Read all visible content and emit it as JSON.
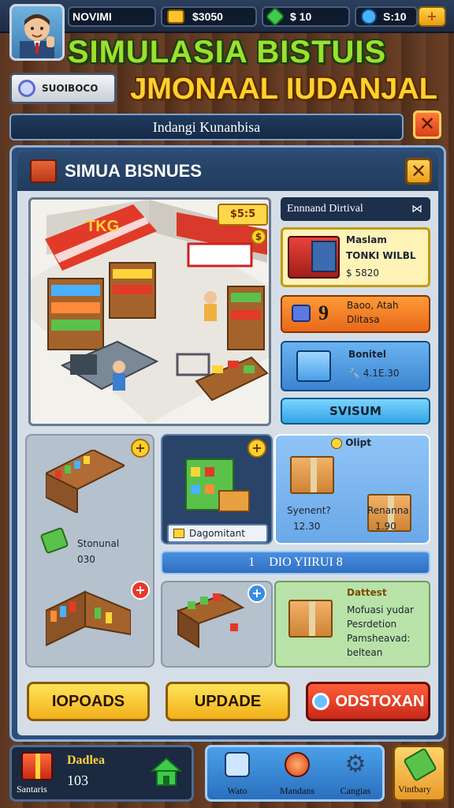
{
  "hud": {
    "player_name": "NOVIMI",
    "currency_1": "$3050",
    "currency_2": "$ 10",
    "currency_3": "S:10",
    "plus_button": "+"
  },
  "title": {
    "line1": "SIMULASIA BISTUIS",
    "line2": "JMONAAL IUDANJAL",
    "badge": "SUOIBOCO"
  },
  "subbar": {
    "label": "Indangi Kunanbisa"
  },
  "panel": {
    "title": "SIMUA BISNUES",
    "scene_price_tag": "$5:5",
    "scene_sign": "TKG"
  },
  "side": {
    "header": "Ennnand Dirtival",
    "card_yellow": {
      "title": "Maslam",
      "line": "TONKI WILBL",
      "price": "$ 5820"
    },
    "card_orange": {
      "number": "9",
      "line1": "Baoo, Atah",
      "line2": "Dlitasa"
    },
    "card_blue": {
      "title": "Bonitel",
      "value": "4.1E.30"
    },
    "button": "SVISUM"
  },
  "tiles": {
    "left_label": "Stonunal",
    "left_value": "030",
    "mid_tag": "Dagomitant",
    "crates_header": "Olipt",
    "crate1_name": "Syenent?",
    "crate1_value": "12.30",
    "crate2_name": "Renanna",
    "crate2_value": "1.90",
    "wide_bar": "DIO YIIRUI 8",
    "wide_bar_number": "1",
    "green_title": "Dattest",
    "green_lines": [
      "Mofuasi yudar",
      "Pesrdetion",
      "Pamsheavad:",
      "beltean"
    ]
  },
  "buttons": {
    "left": "IOPOADS",
    "mid": "UPDADE",
    "right": "ODSTOXAN"
  },
  "nav": {
    "left_label": "Santaris",
    "left_title": "Dadlea",
    "left_value": "103",
    "mid_items": [
      "Wato",
      "Mandans",
      "Cangias"
    ],
    "right_label": "Vintbary"
  },
  "colors": {
    "wood_bg": "#6b4027",
    "panel_blue": "#2c4f7a",
    "title_green": "#9be12f",
    "title_yellow": "#ffd12e",
    "button_yellow": "#f2b01a",
    "button_red": "#c8281a"
  }
}
